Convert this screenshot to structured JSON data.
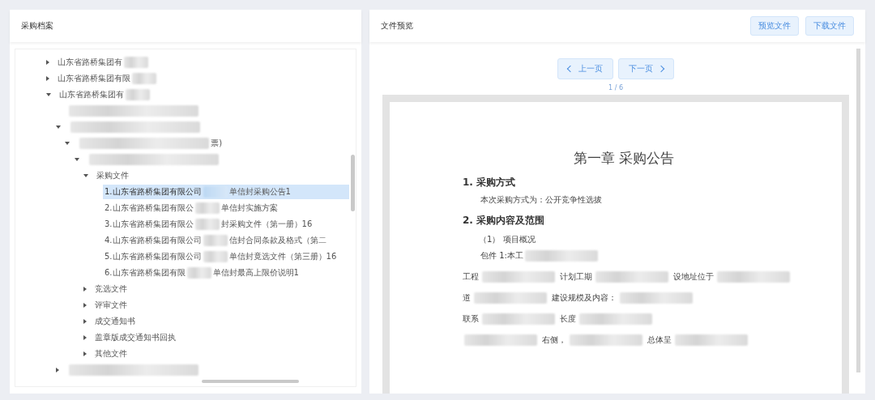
{
  "left_panel": {
    "title": "采购档案"
  },
  "tree": [
    {
      "text": "山东省路桥集团有",
      "redacted": true,
      "expanded": false
    },
    {
      "text": "山东省路桥集团有限",
      "redacted": true,
      "expanded": false
    },
    {
      "text": "山东省路桥集团有",
      "redacted": true,
      "expanded": true,
      "children": [
        {
          "redacted": true
        },
        {
          "redacted": true,
          "expanded": true,
          "children": [
            {
              "redacted": true,
              "text_end": "票)",
              "expanded": true,
              "children": [
                {
                  "redacted": true,
                  "expanded": true,
                  "children": [
                    {
                      "text": "采购文件",
                      "expanded": true,
                      "children": [
                        {
                          "text": "1.山东省路桥集团有限公司",
                          "redacted": true,
                          "text_end": "单信封采购公告1",
                          "selected": true
                        },
                        {
                          "text": "2.山东省路桥集团有限公",
                          "redacted": true,
                          "text_end": "单信封实施方案",
                          "selected": false
                        },
                        {
                          "text": "3.山东省路桥集团有限公",
                          "redacted": true,
                          "text_end": "封采购文件（第一册）16",
                          "selected": false
                        },
                        {
                          "text": "4.山东省路桥集团有限公司",
                          "redacted": true,
                          "text_end": "信封合同条款及格式（第二",
                          "selected": false
                        },
                        {
                          "text": "5.山东省路桥集团有限公司",
                          "redacted": true,
                          "text_end": "单信封竟选文件（第三册）16",
                          "selected": false
                        },
                        {
                          "text": "6.山东省路桥集团有限",
                          "redacted": true,
                          "text_end": "单信封最高上限价说明1",
                          "selected": false
                        }
                      ]
                    },
                    {
                      "text": "竞选文件",
                      "expanded": false
                    },
                    {
                      "text": "评审文件",
                      "expanded": false
                    },
                    {
                      "text": "成交通知书",
                      "expanded": false
                    },
                    {
                      "text": "盖章版成交通知书回执",
                      "expanded": false
                    },
                    {
                      "text": "其他文件",
                      "expanded": false
                    }
                  ]
                }
              ]
            }
          ]
        },
        {
          "redacted": true,
          "expanded": false
        }
      ]
    }
  ],
  "right_panel": {
    "title": "文件预览",
    "buttons": [
      "预览文件",
      "下载文件"
    ]
  },
  "pager": {
    "prev": "上一页",
    "next": "下一页",
    "page": "1 / 6"
  },
  "document": {
    "title": "第一章  采购公告",
    "blocks": [
      {
        "kind": "heading",
        "text": "1.  采购方式"
      },
      {
        "kind": "para",
        "parts": [
          {
            "text": "本次采购方式为：公开竞争性选拔"
          }
        ]
      },
      {
        "kind": "heading",
        "text": "2.  采购内容及范围"
      },
      {
        "kind": "sub",
        "text": "（1）    项目概况"
      },
      {
        "kind": "para",
        "parts": [
          {
            "text": "包件 1:本工"
          },
          {
            "redacted": true
          }
        ]
      },
      {
        "kind": "line",
        "parts": [
          {
            "text": "工程"
          },
          {
            "redacted": true
          },
          {
            "text": "计划工期"
          },
          {
            "redacted": true
          },
          {
            "text": "设地址位于"
          },
          {
            "redacted": true
          }
        ]
      },
      {
        "kind": "line",
        "parts": [
          {
            "text": "道"
          },
          {
            "redacted": true
          },
          {
            "text": "建设规模及内容："
          },
          {
            "redacted": true
          }
        ]
      },
      {
        "kind": "line",
        "parts": [
          {
            "text": "联系"
          },
          {
            "redacted": true
          },
          {
            "text": "长度"
          },
          {
            "redacted": true
          }
        ]
      },
      {
        "kind": "line",
        "parts": [
          {
            "redacted": true
          },
          {
            "text": "右侧，"
          },
          {
            "redacted": true
          },
          {
            "text": "总体呈"
          },
          {
            "redacted": true
          }
        ]
      }
    ]
  }
}
